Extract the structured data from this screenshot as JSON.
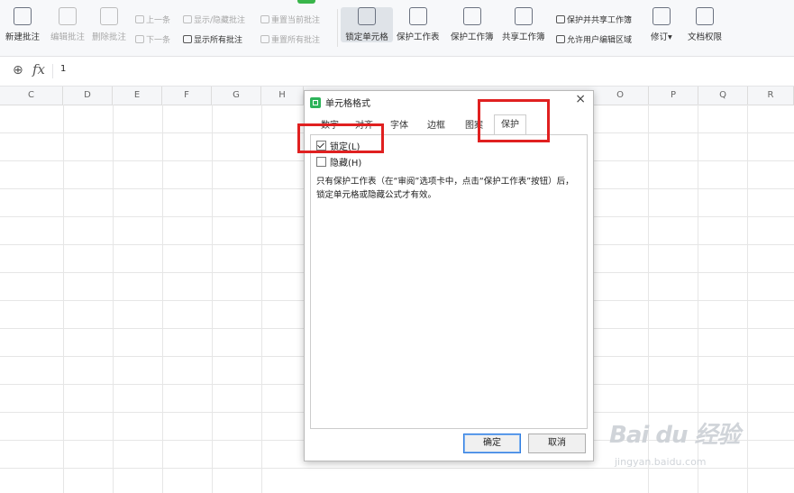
{
  "ribbon": {
    "new_comment": "新建批注",
    "edit_comment": "编辑批注",
    "delete_comment": "删除批注",
    "prev": "上一条",
    "next": "下一条",
    "show_hide_comment": "显示/隐藏批注",
    "show_all_comments": "显示所有批注",
    "reset_current_comment": "重置当前批注",
    "reset_all_comments": "重置所有批注",
    "lock_cell": "锁定单元格",
    "protect_sheet": "保护工作表",
    "protect_workbook": "保护工作簿",
    "share_workbook": "共享工作簿",
    "protect_and_share": "保护并共享工作簿",
    "allow_edit_ranges": "允许用户编辑区域",
    "revise": "修订",
    "doc_permissions": "文档权限"
  },
  "formula_bar": {
    "value": "1",
    "fx": "fx"
  },
  "columns": [
    "C",
    "D",
    "E",
    "F",
    "G",
    "H",
    "O",
    "P",
    "Q",
    "R"
  ],
  "dialog": {
    "title": "单元格格式",
    "close": "×",
    "tabs": [
      "数字",
      "对齐",
      "字体",
      "边框",
      "图案",
      "保护"
    ],
    "selected_tab": "保护",
    "locked_label": "锁定(L)",
    "hidden_label": "隐藏(H)",
    "note": "只有保护工作表（在“审阅”选项卡中，点击“保护工作表”按钮）后，锁定单元格或隐藏公式才有效。",
    "ok": "确定",
    "cancel": "取消"
  },
  "watermark": {
    "brand": "Bai du 经验",
    "url": "jingyan.baidu.com"
  },
  "colors": {
    "highlight": "#e02020",
    "accent": "#2db35a",
    "primary_button": "#2f7de1"
  },
  "icons": [
    "zoom-icon",
    "fx-icon",
    "checkbox-checked-icon",
    "checkbox-empty-icon",
    "close-icon",
    "sheet-logo-icon"
  ]
}
